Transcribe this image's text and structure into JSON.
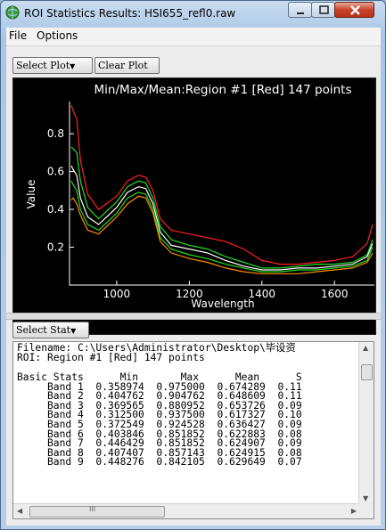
{
  "window": {
    "title": "ROI Statistics Results: HSI655_refl0.raw"
  },
  "menu": {
    "items": [
      "File",
      "Options"
    ]
  },
  "toolbar": {
    "select_plot_label": "Select Plot",
    "clear_plot_label": "Clear Plot"
  },
  "plot": {
    "title": "Min/Max/Mean:Region #1 [Red] 147 points"
  },
  "stats_toolbar": {
    "select_stat_label": "Select Stat"
  },
  "stats": {
    "filename_line": "Filename: C:\\Users\\Administrator\\Desktop\\毕设资",
    "roi_line": "ROI: Region #1 [Red] 147 points",
    "header": "Basic Stats      Min       Max      Mean      S",
    "rows": [
      "     Band 1  0.358974  0.975000  0.674289  0.11",
      "     Band 2  0.404762  0.904762  0.648609  0.11",
      "     Band 3  0.369565  0.880952  0.653726  0.09",
      "     Band 4  0.312500  0.937500  0.617327  0.10",
      "     Band 5  0.372549  0.924528  0.636427  0.09",
      "     Band 6  0.403846  0.851852  0.622883  0.08",
      "     Band 7  0.446429  0.851852  0.624907  0.09",
      "     Band 8  0.407407  0.857143  0.624915  0.08",
      "     Band 9  0.448276  0.842105  0.629649  0.07"
    ],
    "hscroll_marker": "III"
  },
  "chart_data": {
    "type": "line",
    "title": "Min/Max/Mean:Region #1 [Red] 147 points",
    "xlabel": "Wavelength",
    "ylabel": "Value",
    "xlim": [
      870,
      1710
    ],
    "ylim": [
      0.0,
      0.97
    ],
    "xticks": [
      1000,
      1200,
      1400,
      1600
    ],
    "yticks": [
      0.2,
      0.4,
      0.6,
      0.8
    ],
    "colors": {
      "background": "#000000",
      "axes": "#ffffff",
      "max": "#ff2020",
      "min": "#ff8c00",
      "mean": "#ffffff",
      "plus_std": "#22dd22",
      "minus_std": "#22dd22"
    },
    "x": [
      875,
      880,
      890,
      900,
      920,
      950,
      1000,
      1030,
      1060,
      1080,
      1100,
      1120,
      1150,
      1200,
      1250,
      1300,
      1350,
      1400,
      1450,
      1500,
      1550,
      1600,
      1650,
      1690,
      1705
    ],
    "series": [
      {
        "name": "",
        "key": "max",
        "values": [
          0.95,
          0.92,
          0.88,
          0.66,
          0.48,
          0.4,
          0.47,
          0.55,
          0.58,
          0.57,
          0.5,
          0.35,
          0.29,
          0.27,
          0.25,
          0.23,
          0.19,
          0.13,
          0.11,
          0.11,
          0.12,
          0.13,
          0.15,
          0.22,
          0.32
        ]
      },
      {
        "name": "",
        "key": "plus_std",
        "values": [
          0.73,
          0.72,
          0.7,
          0.55,
          0.41,
          0.35,
          0.44,
          0.52,
          0.55,
          0.54,
          0.46,
          0.31,
          0.24,
          0.21,
          0.19,
          0.15,
          0.12,
          0.09,
          0.09,
          0.1,
          0.11,
          0.11,
          0.12,
          0.16,
          0.24
        ]
      },
      {
        "name": "",
        "key": "mean",
        "values": [
          0.63,
          0.61,
          0.58,
          0.46,
          0.36,
          0.32,
          0.41,
          0.49,
          0.52,
          0.51,
          0.43,
          0.28,
          0.21,
          0.19,
          0.17,
          0.13,
          0.1,
          0.08,
          0.08,
          0.09,
          0.09,
          0.1,
          0.11,
          0.15,
          0.22
        ]
      },
      {
        "name": "",
        "key": "minus_std",
        "values": [
          0.55,
          0.53,
          0.5,
          0.4,
          0.32,
          0.29,
          0.38,
          0.46,
          0.49,
          0.48,
          0.4,
          0.25,
          0.19,
          0.16,
          0.14,
          0.11,
          0.09,
          0.07,
          0.07,
          0.08,
          0.08,
          0.09,
          0.1,
          0.13,
          0.2
        ]
      },
      {
        "name": "",
        "key": "min",
        "values": [
          0.45,
          0.46,
          0.43,
          0.37,
          0.29,
          0.27,
          0.36,
          0.43,
          0.47,
          0.46,
          0.38,
          0.23,
          0.17,
          0.14,
          0.12,
          0.09,
          0.07,
          0.06,
          0.06,
          0.06,
          0.07,
          0.08,
          0.09,
          0.12,
          0.17
        ]
      }
    ]
  }
}
